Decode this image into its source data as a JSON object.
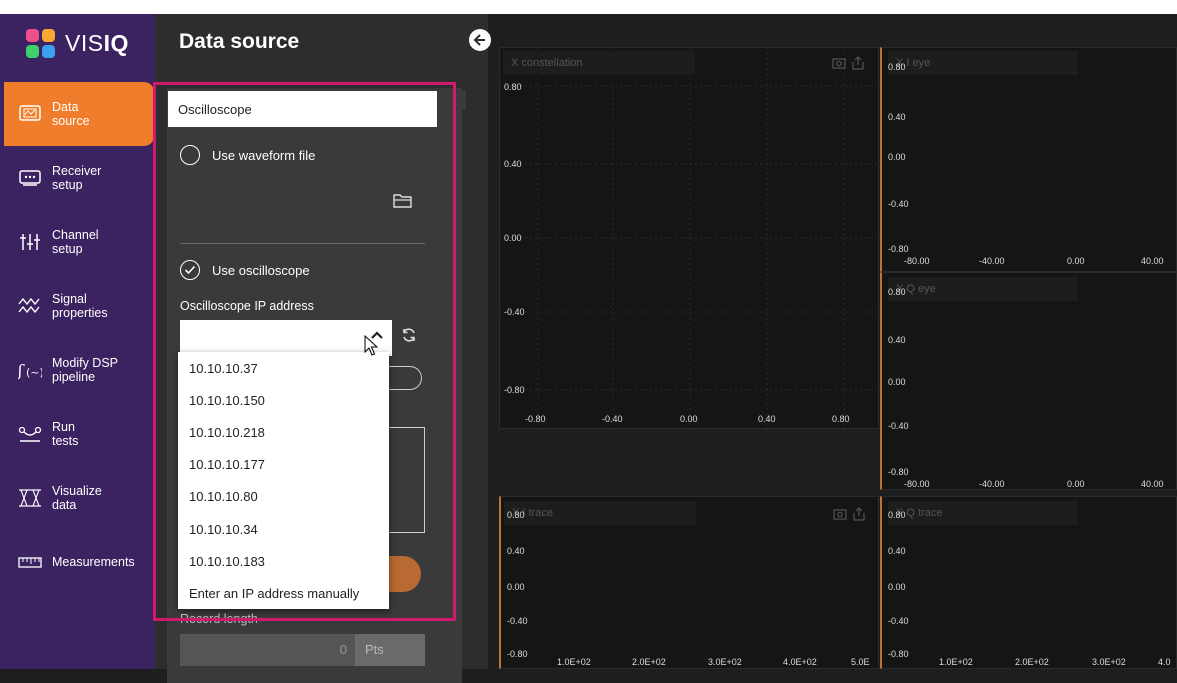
{
  "app": {
    "name_light": "VIS",
    "name_bold": "IQ"
  },
  "colors": {
    "sidebar": "#3a2360",
    "accent": "#f07d2b",
    "highlight": "#d0186e",
    "brand_dots": [
      "#f0508a",
      "#f7a733",
      "#3fd06a",
      "#3aa0f0"
    ]
  },
  "sidebar": {
    "items": [
      {
        "label": "Data\nsource",
        "icon": "data-source-icon",
        "active": true
      },
      {
        "label": "Receiver\nsetup",
        "icon": "receiver-icon",
        "active": false
      },
      {
        "label": "Channel\nsetup",
        "icon": "channel-icon",
        "active": false
      },
      {
        "label": "Signal\nproperties",
        "icon": "signal-icon",
        "active": false
      },
      {
        "label": "Modify DSP\npipeline",
        "icon": "dsp-icon",
        "active": false
      },
      {
        "label": "Run\ntests",
        "icon": "run-icon",
        "active": false
      },
      {
        "label": "Visualize\ndata",
        "icon": "visualize-icon",
        "active": false
      },
      {
        "label": "Measurements",
        "icon": "measurements-icon",
        "active": false
      }
    ]
  },
  "panel": {
    "title": "Data source",
    "card_title": "Oscilloscope",
    "waveform_option": "Use waveform file",
    "scope_option": "Use oscilloscope",
    "ip_label": "Oscilloscope IP address",
    "ip_value": "",
    "ip_options": [
      "10.10.10.37",
      "10.10.10.150",
      "10.10.10.218",
      "10.10.10.177",
      "10.10.10.80",
      "10.10.10.34",
      "10.10.10.183",
      "Enter an IP address manually"
    ],
    "record_label": "Record length",
    "record_value": "0",
    "record_unit": "Pts"
  },
  "plots": {
    "x_constellation": {
      "title": "X constellation",
      "y_ticks": [
        "0.80",
        "0.40",
        "0.00",
        "-0.40",
        "-0.80"
      ],
      "x_ticks": [
        "-0.80",
        "-0.40",
        "0.00",
        "0.40",
        "0.80"
      ]
    },
    "xi_eye": {
      "title": "X I eye",
      "y_ticks": [
        "0.80",
        "0.40",
        "0.00",
        "-0.40",
        "-0.80"
      ],
      "x_ticks": [
        "-80.00",
        "-40.00",
        "0.00",
        "40.00"
      ]
    },
    "xq_eye": {
      "title": "X Q eye",
      "y_ticks": [
        "0.80",
        "0.40",
        "0.00",
        "-0.40",
        "-0.80"
      ],
      "x_ticks": [
        "-80.00",
        "-40.00",
        "0.00",
        "40.00"
      ]
    },
    "xi_trace": {
      "title": "X I trace",
      "y_ticks": [
        "0.80",
        "0.40",
        "0.00",
        "-0.40",
        "-0.80"
      ],
      "x_ticks": [
        "1.0E+02",
        "2.0E+02",
        "3.0E+02",
        "4.0E+02",
        "5.0E"
      ]
    },
    "xq_trace": {
      "title": "X Q trace",
      "y_ticks": [
        "0.80",
        "0.40",
        "0.00",
        "-0.40",
        "-0.80"
      ],
      "x_ticks": [
        "1.0E+02",
        "2.0E+02",
        "3.0E+02",
        "4.0"
      ]
    }
  }
}
